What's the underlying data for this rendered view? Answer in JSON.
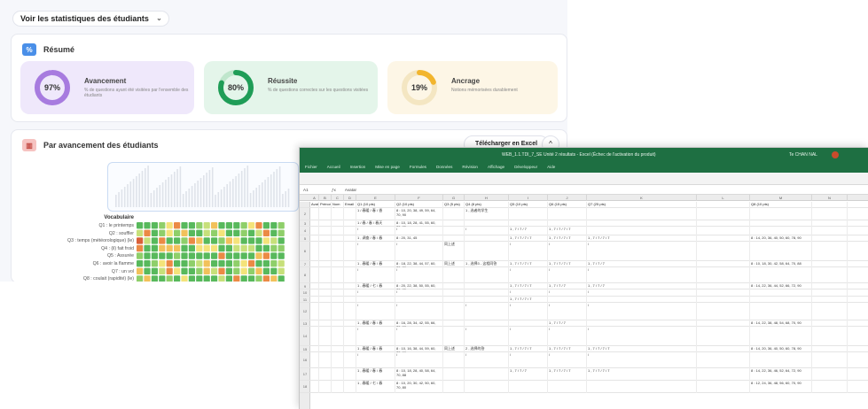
{
  "dashboard": {
    "stats_toggle": "Voir les statistiques des étudiants",
    "resume": {
      "icon_text": "%",
      "title": "Résumé",
      "cards": [
        {
          "key": "avancement",
          "percent_label": "97%",
          "value": 0.97,
          "color": "#a77bdf",
          "track": "#dccdf3",
          "title": "Avancement",
          "desc": "% de questions ayant été visitées par l'ensemble des étudiants"
        },
        {
          "key": "reussite",
          "percent_label": "80%",
          "value": 0.8,
          "color": "#1f9d57",
          "track": "#bfe6cc",
          "title": "Réussite",
          "desc": "% de questions correctes sur les questions visitées"
        },
        {
          "key": "ancrage",
          "percent_label": "19%",
          "value": 0.19,
          "color": "#f2b52e",
          "track": "#f4e6c2",
          "title": "Ancrage",
          "desc": "Notions mémorisées durablement"
        }
      ]
    },
    "avancement": {
      "icon_color": "#f6c3c1",
      "title": "Par avancement des étudiants",
      "download_label": "Télécharger en Excel",
      "collapse_glyph": "^",
      "heatmap_title": "Vocabulaire",
      "question_labels": [
        "Q1 : le printemps",
        "Q2 : souffler",
        "Q3 : temps (météorologique) (le)",
        "Q4 : (il) fait froid",
        "Q5 : Assurée",
        "Q6 : avoir la flamme",
        "Q7 : un vol",
        "Q8 : coulait (rapidité) (le)"
      ]
    }
  },
  "excel": {
    "doc_title": "WEB_1.1.TDI_7_SE Unité 2 résultats - Excel (Échec de l'activation du produit)",
    "user_name": "Te CHAN NAL",
    "tabs": [
      "Fichier",
      "Accueil",
      "Insertion",
      "Mise en page",
      "Formules",
      "Données",
      "Révision",
      "Affichage",
      "Développeur",
      "Aide"
    ],
    "cell_ref": "A1",
    "formula_value": "Avatar",
    "columns": [
      "A",
      "B",
      "C",
      "D",
      "E",
      "F",
      "G",
      "H",
      "I",
      "J",
      "K",
      "L",
      "M",
      "N"
    ],
    "header_row": [
      "Avatar",
      "Prénom",
      "Nom de fam",
      "Email",
      "Q1 (10 pts)",
      "Q2 (10 pts)",
      "Q3 (5 pts)",
      "Q4 (8 pts)",
      "Q5 (10 pts)",
      "Q6 (15 pts)",
      "Q7 (25 pts)",
      "",
      "Q8 (10 pts)",
      ""
    ],
    "rows": [
      {
        "num": "2",
        "cells": [
          "",
          "",
          "",
          "",
          "1 / 春暖 / 春 / 香",
          "8 : 10, 20, 38, 49, 59, 64, 70, 90",
          "",
          "1 , 选者的学生",
          "",
          "",
          "",
          "",
          "",
          ""
        ]
      },
      {
        "num": "3",
        "cells": [
          "",
          "",
          "",
          "",
          "1 / 春 / 春 / 春天",
          "8 : 10, 18, 28, 41, 55, 60, 70, 85",
          "",
          "",
          "",
          "",
          "",
          "",
          "",
          ""
        ]
      },
      {
        "num": "4",
        "cells": [
          "",
          "",
          "",
          "",
          "/",
          "/",
          "",
          "/",
          "1 , 7 / 7 / 7",
          "1 , 7 / 7 / 7 / 7",
          "",
          "",
          "",
          ""
        ]
      },
      {
        "num": "5",
        "cells": [
          "",
          "",
          "",
          "",
          "1 , 调查 / 春 / 春",
          "8 : 20, 31, 45",
          "",
          "",
          "1 , 7 / 7 / 7 / 7",
          "1 , 7 / 7 / 7 / 7",
          "1 , 7 / 7 / 7 / 7",
          "",
          "8 : 14, 20, 36, 40, 50, 60, 78, 90",
          ""
        ]
      },
      {
        "num": "6",
        "cells": [
          "",
          "",
          "",
          "",
          "/",
          "/",
          "同上述",
          "",
          "/",
          "/",
          "/",
          "",
          "",
          ""
        ]
      },
      {
        "num": "7",
        "cells": [
          "",
          "",
          "",
          "",
          "1 , 春暖 / 春 / 春",
          "8 : 18, 22, 38, 44, 57, 60, 70, 86",
          "同上述",
          "1 , 选择3 - 这相同答",
          "1 , 7 / 7 / 7 / 7",
          "1 , 7 / 7 / 7 / 7",
          "1 , 7 / 7 / 7",
          "",
          "8 : 10, 18, 30, 42, 58, 64, 70, 88",
          ""
        ]
      },
      {
        "num": "8",
        "cells": [
          "",
          "",
          "",
          "",
          "/",
          "/",
          "",
          "",
          "/",
          "/",
          "/",
          "",
          "",
          ""
        ]
      },
      {
        "num": "9",
        "cells": [
          "",
          "",
          "",
          "",
          "1 , 春暖 / 七 / 春",
          "8 : 20, 22, 38, 50, 55, 60, 70, 85",
          "",
          "",
          "1 , 7 / 7 / 7 / 7",
          "1 , 7 / 7 / 7",
          "1 , 7 / 7 / 7",
          "",
          "8 : 14, 22, 36, 44, 52, 66, 72, 90",
          ""
        ]
      },
      {
        "num": "10",
        "cells": [
          "",
          "",
          "",
          "",
          "/",
          "/",
          "",
          "",
          "/",
          "/",
          "/",
          "",
          "",
          ""
        ]
      },
      {
        "num": "11",
        "cells": [
          "",
          "",
          "",
          "",
          "",
          "",
          "",
          "",
          "1 , 7 / 7 / 7 / 7",
          "",
          "",
          "",
          "",
          ""
        ]
      },
      {
        "num": "12",
        "cells": [
          "",
          "",
          "",
          "",
          "/",
          "/",
          "",
          "/",
          "/",
          "/",
          "/",
          "",
          "",
          ""
        ]
      },
      {
        "num": "13",
        "cells": [
          "",
          "",
          "",
          "",
          "1 , 春暖 / 春 / 春",
          "8 : 16, 28, 34, 42, 55, 66, 70, 90",
          "",
          "",
          "",
          "1 , 7 / 7 / 7",
          "",
          "",
          "8 : 14, 22, 38, 48, 54, 68, 70, 90",
          ""
        ]
      },
      {
        "num": "14",
        "cells": [
          "",
          "",
          "",
          "",
          "/",
          "/",
          "",
          "/",
          "/",
          "/",
          "/",
          "",
          "",
          ""
        ]
      },
      {
        "num": "15",
        "cells": [
          "",
          "",
          "",
          "",
          "1 , 春暖 / 春 / 春",
          "8 : 10, 16, 38, 44, 59, 60, 72, 90",
          "同上述",
          "2 , 选择的答",
          "1 , 7 / 7 / 7 / 7",
          "1 , 7 / 7 / 7 / 7",
          "1 , 7 / 7 / 7 / 7",
          "",
          "8 : 14, 20, 36, 40, 50, 60, 78, 90",
          ""
        ]
      },
      {
        "num": "16",
        "cells": [
          "",
          "",
          "",
          "",
          "/",
          "/",
          "",
          "/",
          "/",
          "/",
          "/",
          "",
          "",
          ""
        ]
      },
      {
        "num": "17",
        "cells": [
          "",
          "",
          "",
          "",
          "1 , 春暖 / 春 / 春",
          "8 : 10, 18, 28, 40, 58, 64, 70, 88",
          "",
          "",
          "1 , 7 / 7 / 7",
          "1 , 7 / 7 / 7 / 7",
          "1 , 7 / 7 / 7 / 7",
          "",
          "8 : 14, 22, 36, 46, 52, 64, 72, 90",
          ""
        ]
      },
      {
        "num": "18",
        "cells": [
          "",
          "",
          "",
          "",
          "1 , 春暖 / 七 / 春",
          "8 : 10, 20, 30, 42, 50, 60, 70, 80",
          "",
          "",
          "",
          "",
          "",
          "",
          "8 : 12, 24, 36, 48, 56, 60, 70, 90",
          ""
        ]
      }
    ]
  }
}
